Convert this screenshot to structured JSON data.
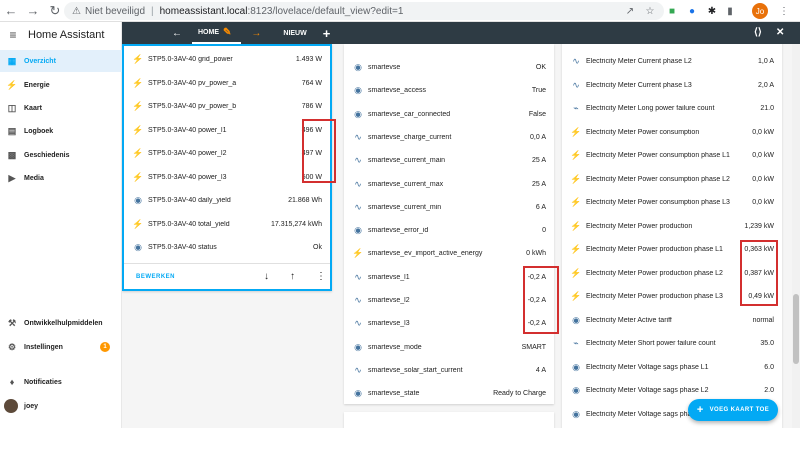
{
  "browser": {
    "security_label": "Niet beveiligd",
    "host": "homeassistant.local",
    "path": ":8123/lovelace/default_view?edit=1",
    "profile_initials": "Jo"
  },
  "sidebar": {
    "title": "Home Assistant",
    "items": [
      {
        "label": "Overzicht",
        "icon": "grid-icon"
      },
      {
        "label": "Energie",
        "icon": "bolt-icon"
      },
      {
        "label": "Kaart",
        "icon": "map-icon"
      },
      {
        "label": "Logboek",
        "icon": "list-icon"
      },
      {
        "label": "Geschiedenis",
        "icon": "chart-icon"
      },
      {
        "label": "Media",
        "icon": "play-icon"
      }
    ],
    "bottom_items": [
      {
        "label": "Ontwikkelhulpmiddelen",
        "icon": "wrench-icon"
      },
      {
        "label": "Instellingen",
        "icon": "gear-icon",
        "badge": "1"
      },
      {
        "label": "Notificaties",
        "icon": "bell-icon"
      },
      {
        "label": "joey",
        "icon": "avatar"
      }
    ]
  },
  "appbar": {
    "home_tab": "HOME",
    "new_tab": "NIEUW"
  },
  "cards": {
    "inverter": {
      "rows": [
        {
          "name": "STP5.0-3AV-40 grid_power",
          "value": "1.493 W",
          "icon": "bolt-icon"
        },
        {
          "name": "STP5.0-3AV-40 pv_power_a",
          "value": "764 W",
          "icon": "bolt-icon"
        },
        {
          "name": "STP5.0-3AV-40 pv_power_b",
          "value": "786 W",
          "icon": "bolt-icon"
        },
        {
          "name": "STP5.0-3AV-40 power_l1",
          "value": "496 W",
          "icon": "bolt-icon"
        },
        {
          "name": "STP5.0-3AV-40 power_l2",
          "value": "497 W",
          "icon": "bolt-icon"
        },
        {
          "name": "STP5.0-3AV-40 power_l3",
          "value": "500 W",
          "icon": "bolt-icon"
        },
        {
          "name": "STP5.0-3AV-40 daily_yield",
          "value": "21.868 Wh",
          "icon": "eye-icon"
        },
        {
          "name": "STP5.0-3AV-40 total_yield",
          "value": "17.315,274 kWh",
          "icon": "bolt-icon"
        },
        {
          "name": "STP5.0-3AV-40 status",
          "value": "Ok",
          "icon": "eye-icon"
        }
      ],
      "edit_label": "BEWERKEN"
    },
    "smartevse": {
      "rows": [
        {
          "name": "smartevse",
          "value": "OK",
          "icon": "eye-icon"
        },
        {
          "name": "smartevse_access",
          "value": "True",
          "icon": "eye-icon"
        },
        {
          "name": "smartevse_car_connected",
          "value": "False",
          "icon": "eye-icon"
        },
        {
          "name": "smartevse_charge_current",
          "value": "0,0 A",
          "icon": "wave-icon"
        },
        {
          "name": "smartevse_current_main",
          "value": "25 A",
          "icon": "wave-icon"
        },
        {
          "name": "smartevse_current_max",
          "value": "25 A",
          "icon": "wave-icon"
        },
        {
          "name": "smartevse_current_min",
          "value": "6 A",
          "icon": "wave-icon"
        },
        {
          "name": "smartevse_error_id",
          "value": "0",
          "icon": "eye-icon"
        },
        {
          "name": "smartevse_ev_import_active_energy",
          "value": "0 kWh",
          "icon": "bolt-icon"
        },
        {
          "name": "smartevse_l1",
          "value": "-0,2 A",
          "icon": "wave-icon"
        },
        {
          "name": "smartevse_l2",
          "value": "-0,2 A",
          "icon": "wave-icon"
        },
        {
          "name": "smartevse_l3",
          "value": "-0,2 A",
          "icon": "wave-icon"
        },
        {
          "name": "smartevse_mode",
          "value": "SMART",
          "icon": "eye-icon"
        },
        {
          "name": "smartevse_solar_start_current",
          "value": "4 A",
          "icon": "wave-icon"
        },
        {
          "name": "smartevse_state",
          "value": "Ready to Charge",
          "icon": "eye-icon"
        }
      ]
    },
    "meter": {
      "rows": [
        {
          "name": "Electricity Meter Current phase L2",
          "value": "1,0 A",
          "icon": "wave-icon"
        },
        {
          "name": "Electricity Meter Current phase L3",
          "value": "2,0 A",
          "icon": "wave-icon"
        },
        {
          "name": "Electricity Meter Long power failure count",
          "value": "21.0",
          "icon": "bolt-off-icon"
        },
        {
          "name": "Electricity Meter Power consumption",
          "value": "0,0 kW",
          "icon": "bolt-icon"
        },
        {
          "name": "Electricity Meter Power consumption phase L1",
          "value": "0,0 kW",
          "icon": "bolt-icon"
        },
        {
          "name": "Electricity Meter Power consumption phase L2",
          "value": "0,0 kW",
          "icon": "bolt-icon"
        },
        {
          "name": "Electricity Meter Power consumption phase L3",
          "value": "0,0 kW",
          "icon": "bolt-icon"
        },
        {
          "name": "Electricity Meter Power production",
          "value": "1,239 kW",
          "icon": "bolt-icon"
        },
        {
          "name": "Electricity Meter Power production phase L1",
          "value": "0,363 kW",
          "icon": "bolt-icon"
        },
        {
          "name": "Electricity Meter Power production phase L2",
          "value": "0,387 kW",
          "icon": "bolt-icon"
        },
        {
          "name": "Electricity Meter Power production phase L3",
          "value": "0,49 kW",
          "icon": "bolt-icon"
        },
        {
          "name": "Electricity Meter Active tariff",
          "value": "normal",
          "icon": "eye-icon"
        },
        {
          "name": "Electricity Meter Short power failure count",
          "value": "35.0",
          "icon": "bolt-off-icon"
        },
        {
          "name": "Electricity Meter Voltage sags phase L1",
          "value": "6.0",
          "icon": "eye-icon"
        },
        {
          "name": "Electricity Meter Voltage sags phase L2",
          "value": "2.0",
          "icon": "eye-icon"
        },
        {
          "name": "Electricity Meter Voltage sags phase L3",
          "value": "",
          "icon": "eye-icon"
        }
      ]
    }
  },
  "fab": {
    "label": "VOEG KAART TOE"
  }
}
